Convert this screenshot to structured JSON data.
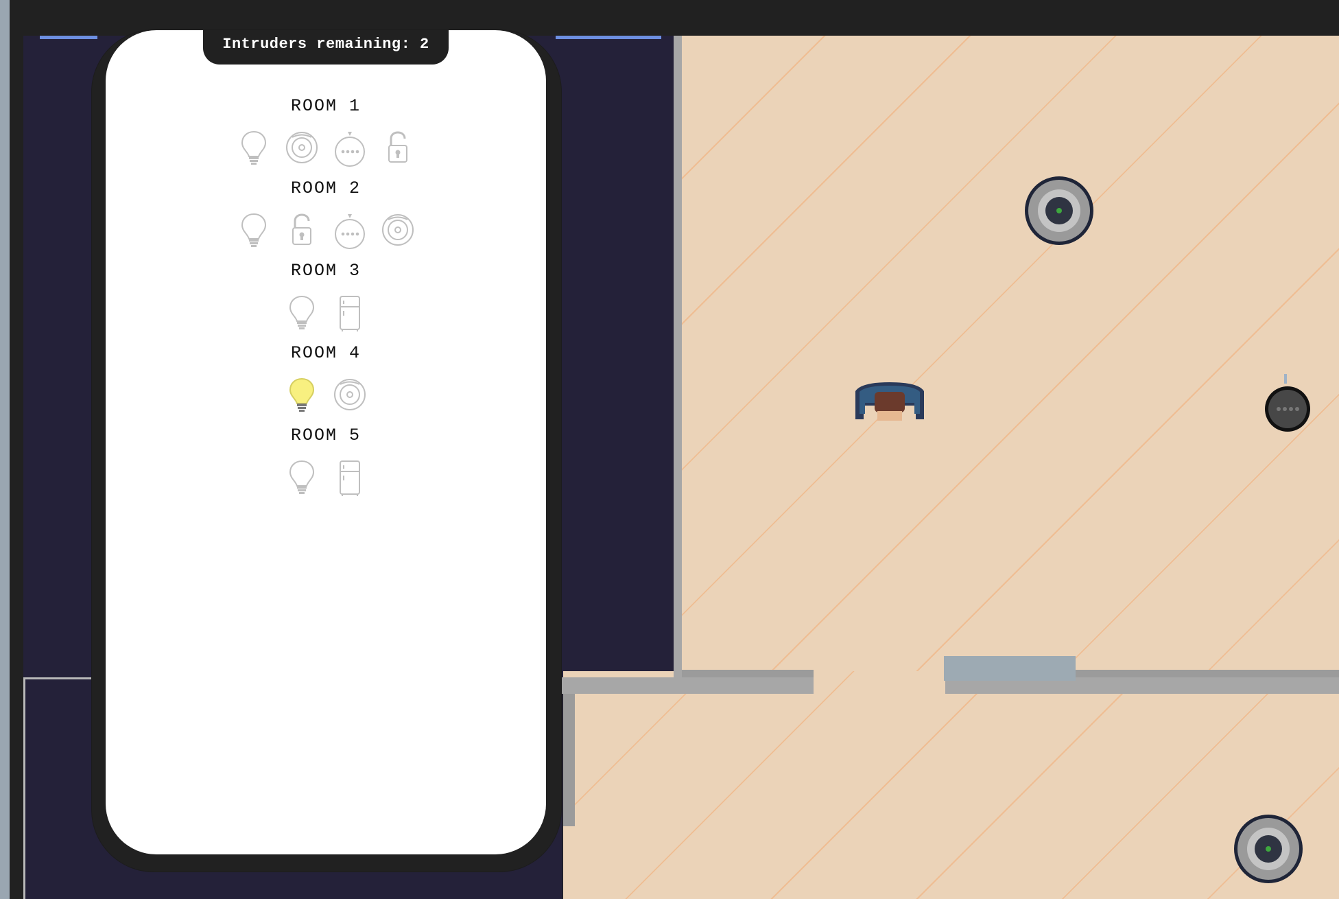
{
  "hud": {
    "intruders_label": "Intruders remaining: 2"
  },
  "phone": {
    "rooms": [
      {
        "title": "ROOM 1",
        "devices": [
          {
            "type": "bulb",
            "active": false
          },
          {
            "type": "robot-vacuum",
            "active": false
          },
          {
            "type": "smart-speaker",
            "active": false
          },
          {
            "type": "lock",
            "active": false
          }
        ]
      },
      {
        "title": "ROOM 2",
        "devices": [
          {
            "type": "bulb",
            "active": false
          },
          {
            "type": "lock",
            "active": false
          },
          {
            "type": "smart-speaker",
            "active": false
          },
          {
            "type": "robot-vacuum",
            "active": false
          }
        ]
      },
      {
        "title": "ROOM 3",
        "devices": [
          {
            "type": "bulb",
            "active": false
          },
          {
            "type": "fridge",
            "active": false
          }
        ]
      },
      {
        "title": "ROOM 4",
        "devices": [
          {
            "type": "bulb",
            "active": true
          },
          {
            "type": "robot-vacuum",
            "active": false
          }
        ]
      },
      {
        "title": "ROOM 5",
        "devices": [
          {
            "type": "bulb",
            "active": false
          },
          {
            "type": "fridge",
            "active": false
          }
        ]
      }
    ]
  },
  "colors": {
    "outside": "#242139",
    "floor": "#ebd3b8",
    "floor_stripe": "#f2ab74",
    "wall": "#a7a7a7",
    "door": "#9daab3",
    "phone_frame": "#212121",
    "bulb_on": "#f8f080",
    "icon_gray": "#bfbfbf"
  }
}
